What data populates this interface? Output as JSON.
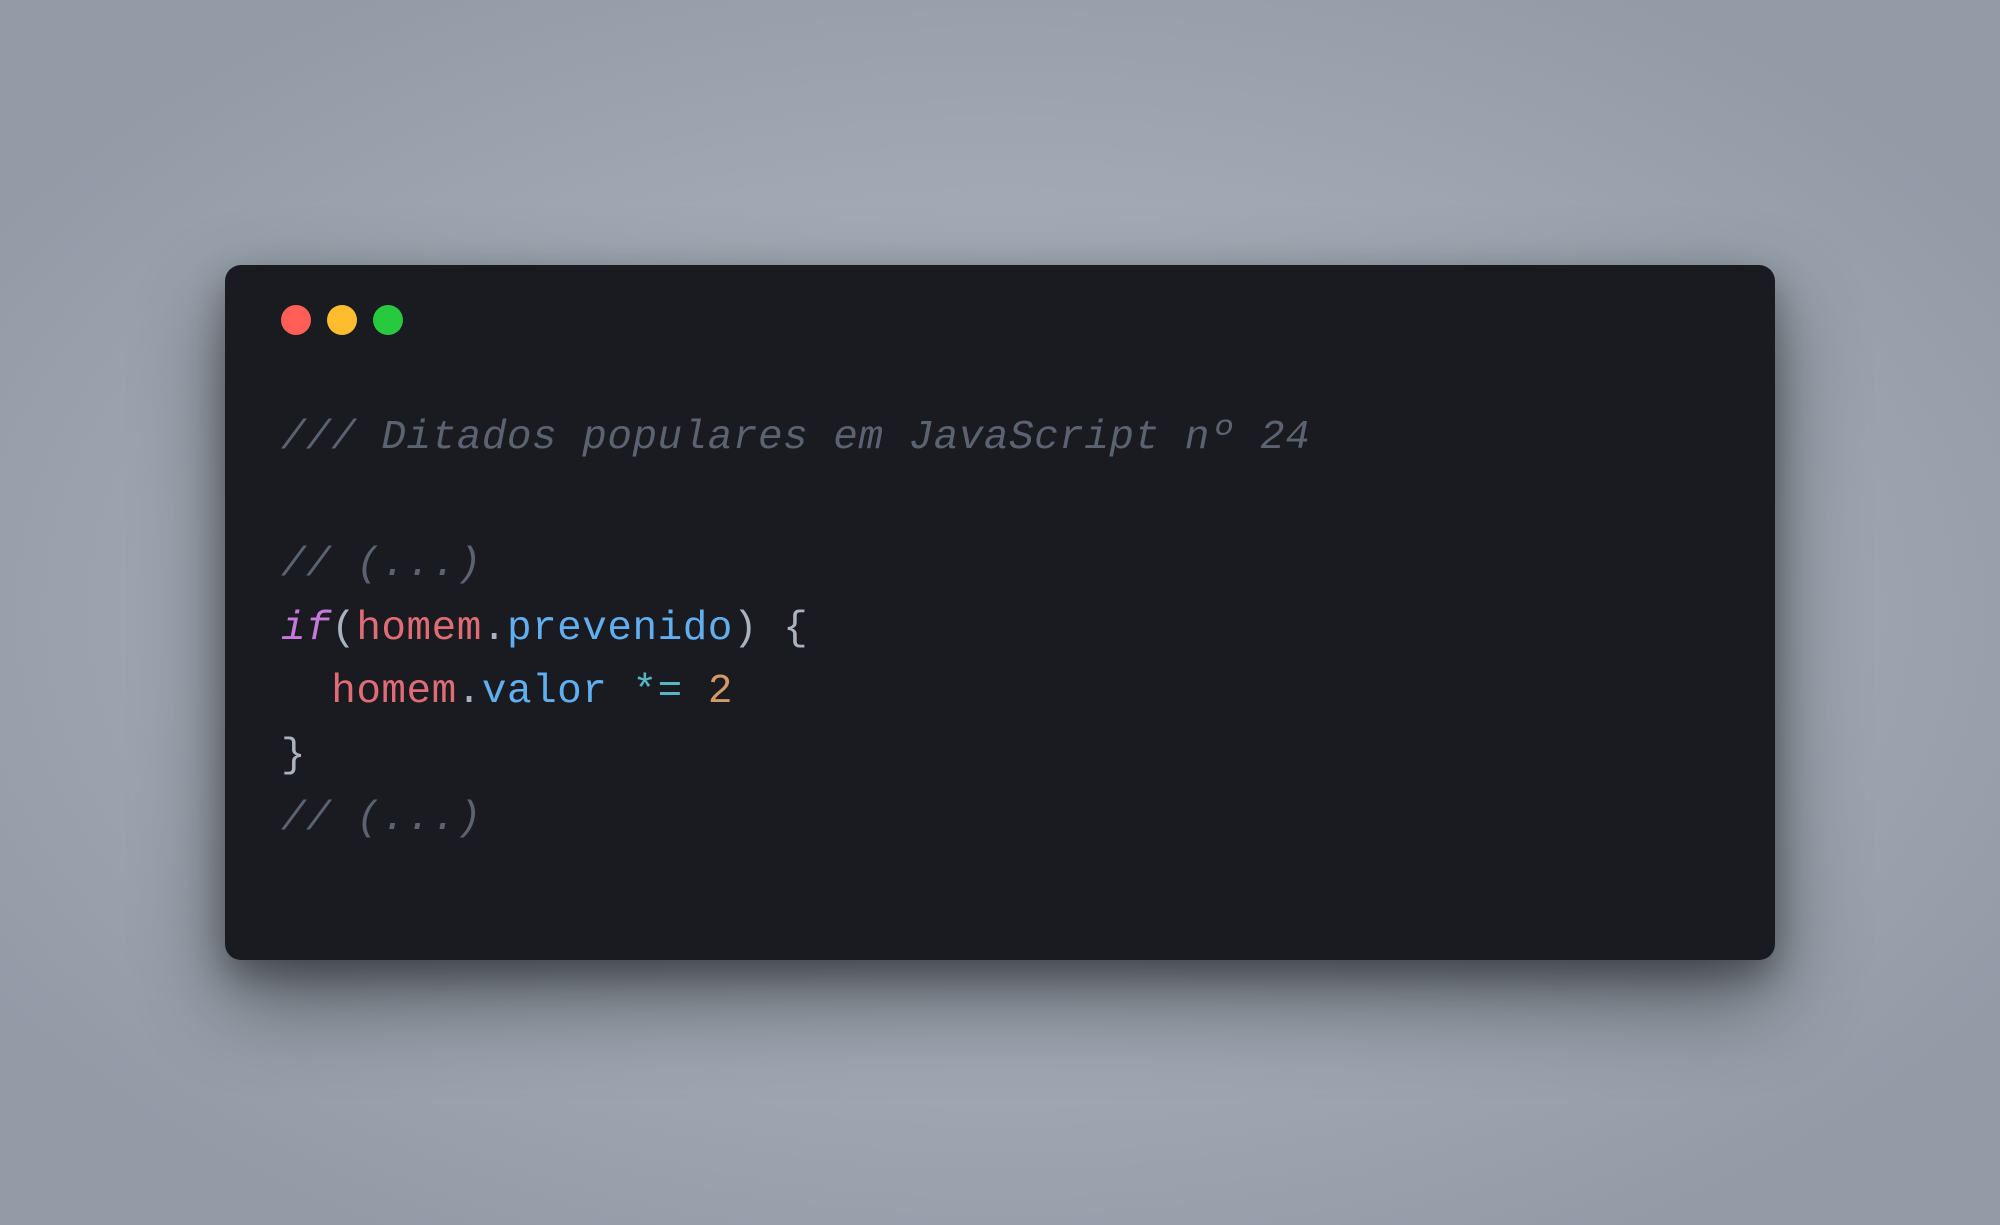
{
  "window": {
    "traffic_lights": {
      "close": "red",
      "minimize": "yellow",
      "zoom": "green"
    }
  },
  "code": {
    "line1_comment": "/// Ditados populares em JavaScript nº 24",
    "line2_blank": "",
    "line3_comment": "// (...)",
    "line4_keyword_if": "if",
    "line4_paren_open": "(",
    "line4_obj": "homem",
    "line4_dot": ".",
    "line4_prop": "prevenido",
    "line4_paren_close": ")",
    "line4_brace_open": " {",
    "line5_indent": "  ",
    "line5_obj": "homem",
    "line5_dot": ".",
    "line5_prop": "valor",
    "line5_space1": " ",
    "line5_op": "*=",
    "line5_space2": " ",
    "line5_num": "2",
    "line6_brace_close": "}",
    "line7_comment": "// (...)"
  }
}
